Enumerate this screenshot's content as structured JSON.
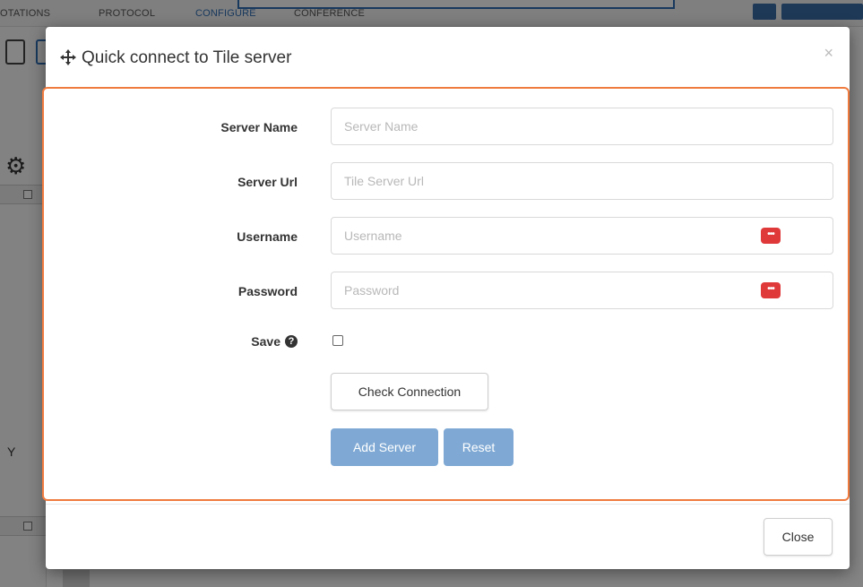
{
  "background": {
    "tabs": [
      "OTATIONS",
      "PROTOCOL",
      "CONFIGURE",
      "CONFERENCE"
    ],
    "side_letter": "Y"
  },
  "dialog": {
    "title": "Quick connect to Tile server",
    "close_x": "×",
    "fields": {
      "server_name": {
        "label": "Server Name",
        "placeholder": "Server Name",
        "value": ""
      },
      "server_url": {
        "label": "Server Url",
        "placeholder": "Tile Server Url",
        "value": ""
      },
      "username": {
        "label": "Username",
        "placeholder": "Username",
        "value": ""
      },
      "password": {
        "label": "Password",
        "placeholder": "Password",
        "value": ""
      }
    },
    "save": {
      "label": "Save",
      "checked": false
    },
    "buttons": {
      "check_connection": "Check Connection",
      "add_server": "Add Server",
      "reset": "Reset",
      "close": "Close"
    },
    "password_manager_badge": "•••"
  },
  "colors": {
    "highlight_border": "#f07b3f",
    "primary_button": "#7fa9d4",
    "badge_red": "#e0393a"
  }
}
